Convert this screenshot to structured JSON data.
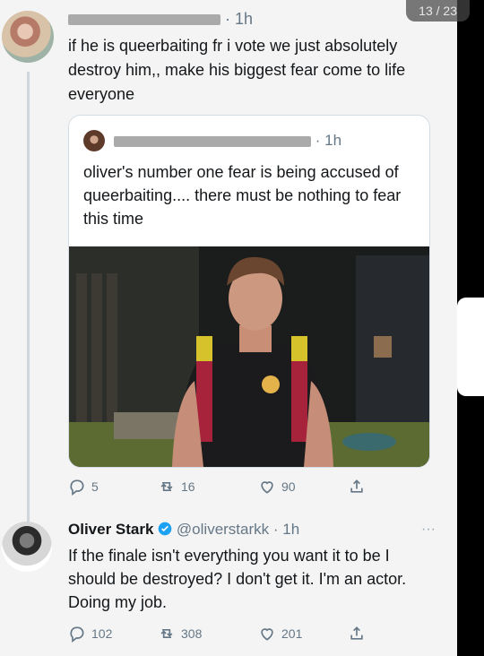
{
  "viewer": {
    "counter": "13 / 23"
  },
  "tweet1": {
    "time": "1h",
    "text": "if he is queerbaiting fr i vote we just absolutely destroy him,, make his biggest fear come to life everyone"
  },
  "quote": {
    "time": "1h",
    "text": "oliver's number one fear is being accused of queerbaiting.... there must be nothing to fear this time",
    "actions": {
      "replies": "5",
      "retweets": "16",
      "likes": "90"
    }
  },
  "reply": {
    "name": "Oliver Stark",
    "handle": "@oliverstarkk",
    "time": "1h",
    "text": "If the finale isn't everything you want it to be I should be destroyed? I don't get it. I'm an actor. Doing my job.",
    "actions": {
      "replies": "102",
      "retweets": "308",
      "likes": "201"
    }
  },
  "colors": {
    "verified": "#1da1f2",
    "muted": "#657786",
    "text": "#14171a"
  },
  "icons": [
    "reply-icon",
    "retweet-icon",
    "like-icon",
    "share-icon",
    "verified-icon",
    "more-icon"
  ]
}
